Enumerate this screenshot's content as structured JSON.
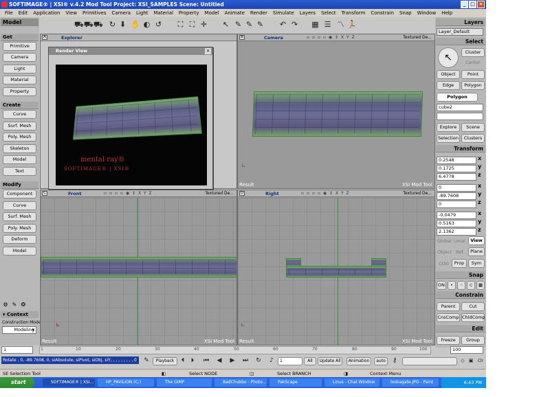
{
  "window": {
    "title": "SOFTIMAGE® | XSI® v.4.2 Mod Tool  Project: XSI_SAMPLES   Scene: Untitled",
    "btn_min": "_",
    "btn_max": "□",
    "btn_close": "×"
  },
  "menubar": {
    "items": [
      "File",
      "Edit",
      "Application",
      "View",
      "Primitives",
      "Camera",
      "Light",
      "Material",
      "Property",
      "Model",
      "Animate",
      "Render",
      "Simulate",
      "Layers",
      "Select",
      "Transform",
      "Constrain",
      "Snap",
      "Window",
      "Help"
    ]
  },
  "left_panel": {
    "model_header": "Model",
    "get_header": "Get",
    "get_items": [
      "Primitive",
      "Camera",
      "Light",
      "Material",
      "Property"
    ],
    "create_header": "Create",
    "create_items": [
      "Curve",
      "Surf. Mesh",
      "Poly. Mesh",
      "Skeleton",
      "Model",
      "Text"
    ],
    "modify_header": "Modify",
    "modify_items": [
      "Component",
      "Curve",
      "Surf. Mesh",
      "Poly. Mesh",
      "Deform",
      "Model"
    ],
    "context_header": "▾ Context",
    "construction_mode_label": "Construction Mode",
    "construction_mode_value": "Modeling"
  },
  "viewports": {
    "a": {
      "letter": "A",
      "name": "Explorer"
    },
    "b": {
      "letter": "B",
      "name": "Camera",
      "mode": "Textured De...",
      "foot_left": "Result",
      "foot_right": "XSI  Mod  Tool"
    },
    "c": {
      "letter": "C",
      "name": "Front",
      "mode": "Textured De...",
      "foot_left": "Result",
      "foot_right": "XSI  Mod  Tool"
    },
    "d": {
      "letter": "D",
      "name": "Right",
      "mode": "Textured De...",
      "foot_left": "Result",
      "foot_right": "XSI  Mod  Tool"
    },
    "icons": "▫ ▫ ▫ ▫  ◉ ↕ X Y Z"
  },
  "render_view": {
    "title": "Render View",
    "close": "×",
    "logo_line1": "mental ray®",
    "logo_line2": "SOFTIMAGE® | XSI®"
  },
  "right_panel": {
    "layers_header": "Layers",
    "layer_value": "Layer_Default",
    "select_header": "Select",
    "select_buttons": [
      "Cluster",
      "Center",
      "Object",
      "Point",
      "Edge",
      "Polygon",
      "Polygon"
    ],
    "selected_name": "cube2",
    "explore": "Explore",
    "scene": "Scene",
    "selection": "Selection",
    "clusters": "Clusters",
    "transform_header": "Transform",
    "scale": [
      "0.2548",
      "0.1725",
      "6.4778"
    ],
    "rotation": [
      "0",
      "-89.7608",
      "0"
    ],
    "translation": [
      "-0.0479",
      "0.5163",
      "2.1362"
    ],
    "axes": [
      "x",
      "y",
      "z"
    ],
    "mode_row1": [
      "Global",
      "Local",
      "View"
    ],
    "mode_row2": [
      "Object",
      "Ref",
      "Plane"
    ],
    "mode_row3": [
      "COG",
      "Prop",
      "Sym"
    ],
    "snap_header": "Snap",
    "snap_on": "ON",
    "constrain_header": "Constrain",
    "constrain_buttons": [
      "Parent",
      "Cut",
      "CnsComp",
      "ChldComp"
    ],
    "edit_header": "Edit",
    "edit_buttons": [
      "Freeze",
      "Group"
    ]
  },
  "timeline": {
    "start": "1",
    "end": "100",
    "ticks": [
      "1",
      "10",
      "20",
      "30",
      "40",
      "50",
      "60",
      "70",
      "80",
      "90",
      "100"
    ]
  },
  "playbar": {
    "command": "Rotate , 0, -89.7608, 0, siAbsolute, siPivot, siObj, siY, , , , , , , , , 0",
    "playback": "Playback",
    "frame": "1",
    "all": "All",
    "update_all": "Update All",
    "animation": "Animation",
    "auto": "auto"
  },
  "status": {
    "tool": "SE Selection Tool",
    "left": "Select NODE",
    "mid": "Select BRANCH",
    "right": "Context Menu"
  },
  "taskbar": {
    "start": "start",
    "tasks": [
      "SOFTIMAGE® | XSI...",
      "HP_PAVILION (C:)",
      "The GIMP",
      "BadChubbo - Photo...",
      "PakScape",
      "Linus - Chat Window",
      "lookagate.JPG - Paint"
    ],
    "clock": "6:43 PM"
  }
}
